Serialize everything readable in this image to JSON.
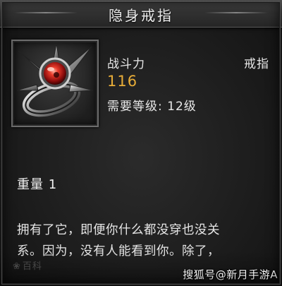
{
  "tooltip": {
    "title": "隐身戒指",
    "stat_label": "战斗力",
    "item_type": "戒指",
    "stat_value": "116",
    "level_requirement": "需要等级: 12级",
    "weight": "重量 1",
    "description_lines": [
      "拥有了它，即便你什么都没穿也没关",
      "系。因为，没有人能看到你。除了，"
    ],
    "item_icon": "ring-with-red-gem-icon",
    "stat_value_color": "#e8ad38"
  },
  "watermarks": {
    "logo_text": "百科",
    "source_text": "搜狐号@新月手游A"
  }
}
